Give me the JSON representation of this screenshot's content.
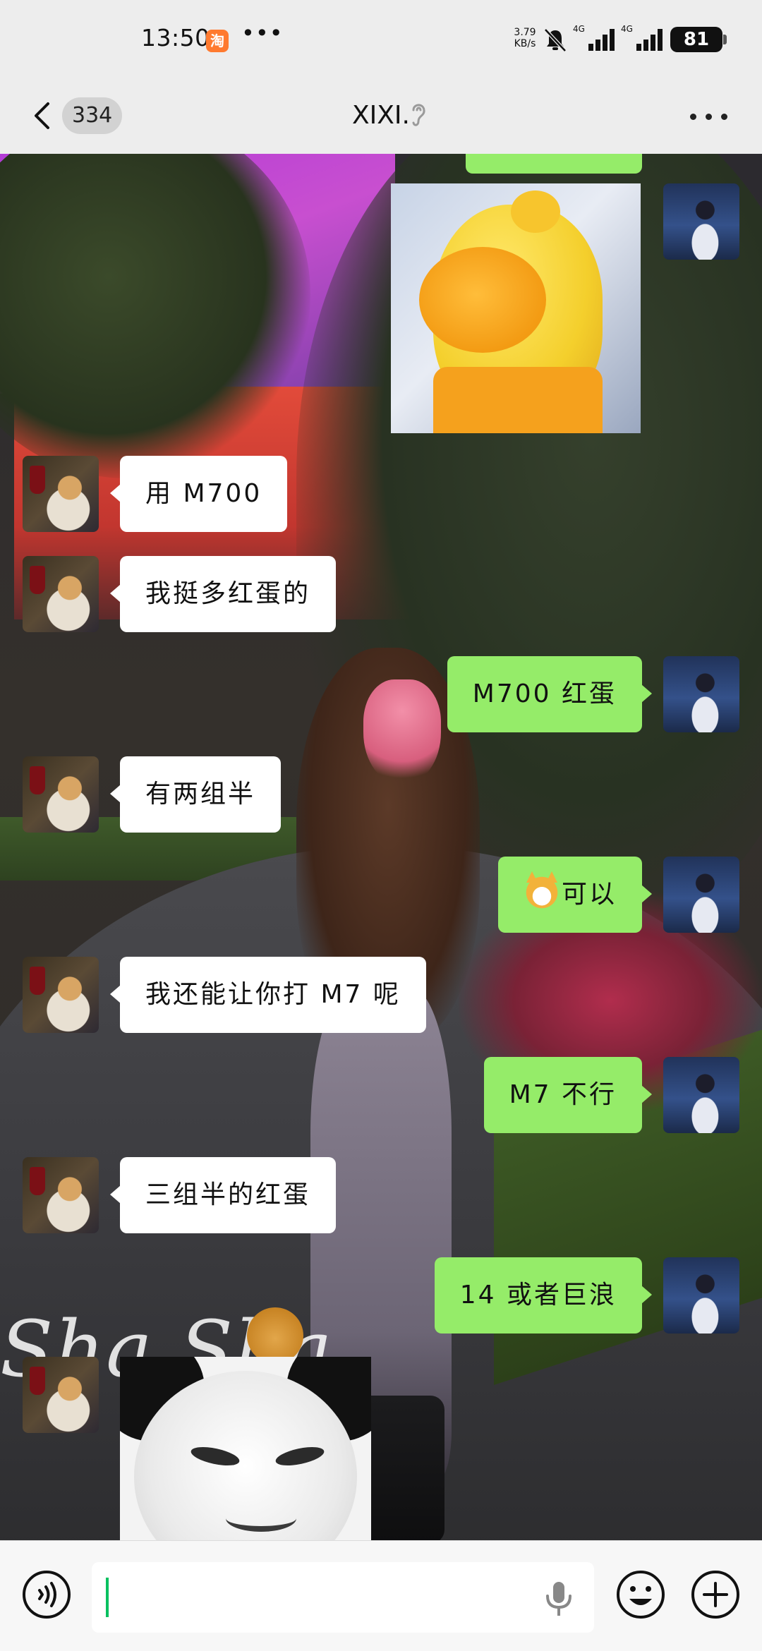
{
  "status_bar": {
    "time": "13:50",
    "shopping_app_badge": "淘",
    "more_notifications": "•••",
    "net_speed_value": "3.79",
    "net_speed_unit": "KB/s",
    "signal_1_label": "4G",
    "signal_2_label": "4G",
    "battery_level": "81",
    "icons": [
      "taobao-icon",
      "mute-bell-icon",
      "signal-icon",
      "signal-icon",
      "battery-icon"
    ]
  },
  "header": {
    "unread_count": "334",
    "chat_title": "XIXI.",
    "icons": [
      "back-chevron-icon",
      "ear-icon",
      "more-dots-icon"
    ]
  },
  "messages": [
    {
      "sender": "self",
      "type": "sticker",
      "sticker": "yellow-duck-sticker"
    },
    {
      "sender": "other",
      "type": "text",
      "text": "用 M700"
    },
    {
      "sender": "other",
      "type": "text",
      "text": "我挺多红蛋的"
    },
    {
      "sender": "self",
      "type": "text",
      "text": "M700 红蛋"
    },
    {
      "sender": "other",
      "type": "text",
      "text": "有两组半"
    },
    {
      "sender": "self",
      "type": "text",
      "emoji": "doge-emoji",
      "text": "可以"
    },
    {
      "sender": "other",
      "type": "text",
      "text": "我还能让你打 M7 呢"
    },
    {
      "sender": "self",
      "type": "text",
      "text": "M7 不行"
    },
    {
      "sender": "other",
      "type": "text",
      "text": "三组半的红蛋"
    },
    {
      "sender": "self",
      "type": "text",
      "text": "14 或者巨浪"
    },
    {
      "sender": "other",
      "type": "sticker",
      "sticker": "panda-face-sticker"
    }
  ],
  "wallpaper": {
    "watermark_text": "Sha Sha"
  },
  "input_bar": {
    "placeholder": "",
    "icons": [
      "voice-icon",
      "mic-icon",
      "emoji-icon",
      "plus-icon"
    ]
  },
  "colors": {
    "self_bubble": "#95ec69",
    "other_bubble": "#ffffff",
    "bar_background": "#ededed",
    "caret": "#07c160"
  }
}
